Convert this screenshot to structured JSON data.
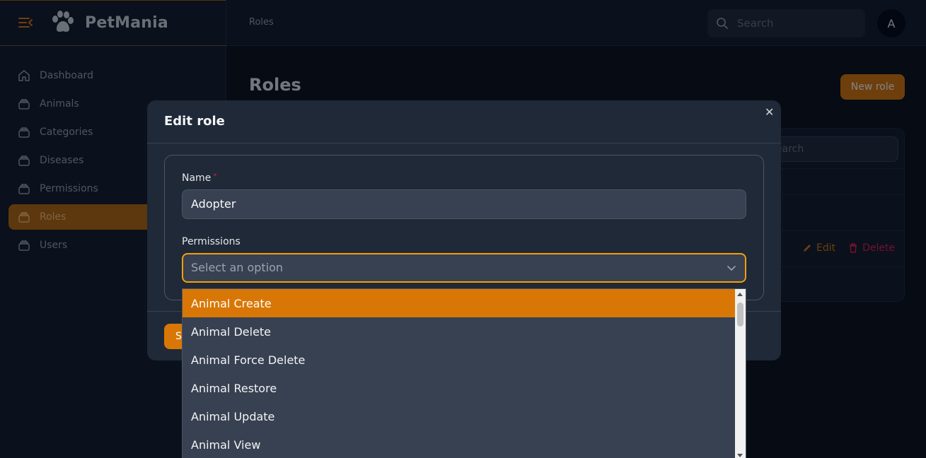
{
  "app": {
    "name": "PetMania"
  },
  "sidebar": {
    "items": [
      {
        "label": "Dashboard",
        "icon": "home-icon"
      },
      {
        "label": "Animals",
        "icon": "stack-icon"
      },
      {
        "label": "Categories",
        "icon": "stack-icon"
      },
      {
        "label": "Diseases",
        "icon": "stack-icon"
      },
      {
        "label": "Permissions",
        "icon": "stack-icon"
      },
      {
        "label": "Roles",
        "icon": "stack-icon",
        "active": true
      },
      {
        "label": "Users",
        "icon": "stack-icon"
      }
    ]
  },
  "topbar": {
    "breadcrumb": "Roles",
    "search_placeholder": "Search",
    "avatar_initial": "A"
  },
  "page": {
    "title": "Roles",
    "new_button": "New role",
    "table_search_placeholder": "earch",
    "row_actions": {
      "edit": "Edit",
      "delete": "Delete"
    }
  },
  "modal": {
    "title": "Edit role",
    "name_label": "Name",
    "required_mark": "*",
    "name_value": "Adopter",
    "permissions_label": "Permissions",
    "permissions_placeholder": "Select an option",
    "save_button_visible": "S",
    "options": [
      "Animal Create",
      "Animal Delete",
      "Animal Force Delete",
      "Animal Restore",
      "Animal Update",
      "Animal View"
    ],
    "highlighted_option": "Animal Create"
  },
  "colors": {
    "accent": "#d97706",
    "danger": "#e11d48",
    "bg": "#0b0f17"
  }
}
